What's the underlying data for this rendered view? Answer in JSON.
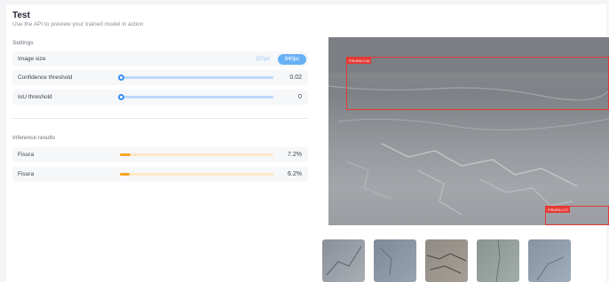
{
  "header": {
    "title": "Test",
    "subtitle": "Use the API to preview your trained model in action"
  },
  "settings": {
    "label": "Settings",
    "image_size": {
      "label": "Image size",
      "options": [
        "320px",
        "640px"
      ],
      "selected": "640px"
    },
    "confidence": {
      "label": "Confidence threshold",
      "value": "0.02"
    },
    "iou": {
      "label": "IoU threshold",
      "value": "0"
    }
  },
  "results": {
    "label": "Inference results",
    "items": [
      {
        "label": "Fisura",
        "value": "7.2%",
        "fraction": 0.072
      },
      {
        "label": "Fisura",
        "value": "6.2%",
        "fraction": 0.062
      }
    ]
  },
  "preview": {
    "detections": [
      {
        "tag": "FISURA 0.06"
      },
      {
        "tag": "FISURA 0.07"
      }
    ],
    "box_color": "#e53935"
  },
  "colors": {
    "accent": "#69b1f5",
    "slider": "#3a8ef0",
    "progress": "#f5a623"
  }
}
